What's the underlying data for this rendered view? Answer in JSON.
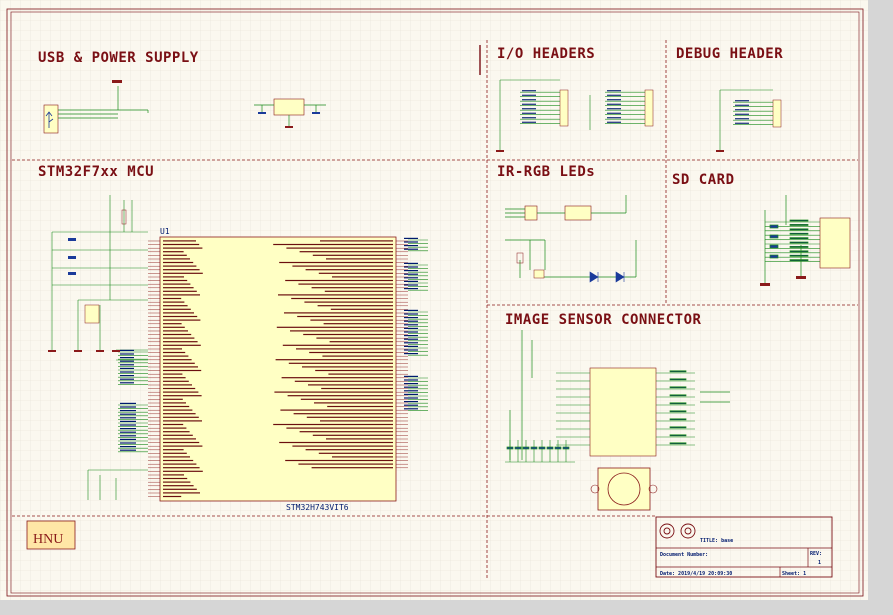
{
  "colors": {
    "sheet": "#fbf8ef",
    "grid": "#e6e1d5",
    "border": "#7a0f14",
    "wire": "#1a8a1a",
    "ic_fill": "#ffffc4",
    "ic_stroke": "#8a1a1a",
    "net_text": "#001a6e",
    "section_text": "#7a0f14",
    "logo_fill": "#ffe6a6",
    "logo_text": "#8a1a1a"
  },
  "sections": {
    "usb": "USB & POWER SUPPLY",
    "mcu": "STM32F7xx MCU",
    "io": "I/O HEADERS",
    "debug": "DEBUG HEADER",
    "ir": "IR-RGB LEDs",
    "sd": "SD CARD",
    "image": "IMAGE SENSOR CONNECTOR"
  },
  "mcu": {
    "ref": "U1",
    "part": "STM32H743VIT6"
  },
  "logo": "HNU",
  "title_block": {
    "title": "TITLE:  base",
    "doc_number": "Document Number:",
    "rev_label": "REV:",
    "rev_value": "1",
    "date": "Date: 2019/4/19 20:09:30",
    "sheet": "Sheet: 1"
  },
  "icons": {
    "usb": "usb-connector-icon",
    "lens": "camera-lens-icon",
    "title_logo": "circles-logo-icon"
  }
}
